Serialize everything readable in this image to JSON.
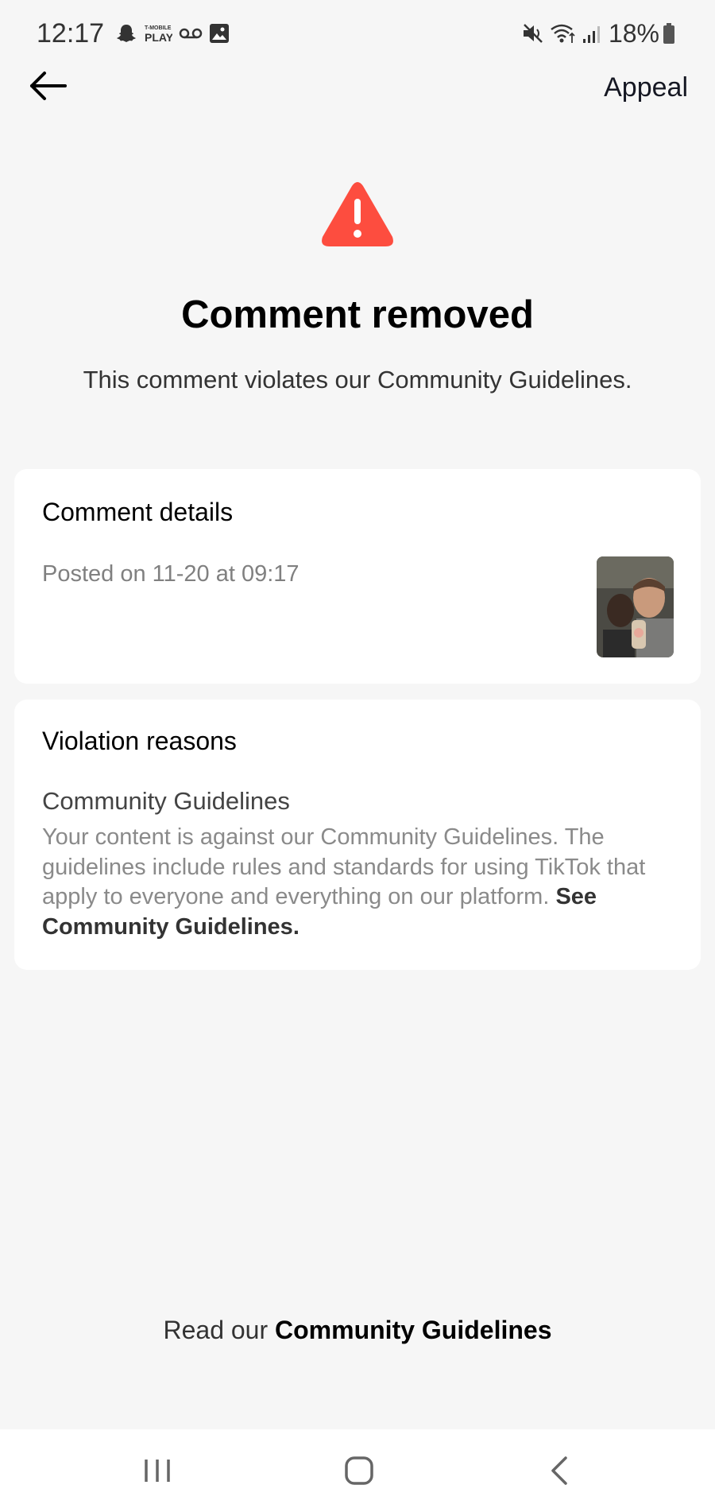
{
  "status_bar": {
    "time": "12:17",
    "battery_percent": "18%",
    "left_icons": [
      "snapchat-icon",
      "tmobile-play-icon",
      "voicemail-icon",
      "gallery-icon"
    ],
    "right_icons": [
      "mute-icon",
      "wifi-icon",
      "signal-icon",
      "battery-icon"
    ],
    "tmobile_label": "T-MOBILE",
    "play_label": "PLAY"
  },
  "nav": {
    "back_icon": "arrow-left-icon",
    "appeal_label": "Appeal"
  },
  "header": {
    "icon": "warning-triangle-icon",
    "title": "Comment removed",
    "subtitle": "This comment violates our Community Guidelines."
  },
  "comment_details": {
    "title": "Comment details",
    "posted_on": "Posted on 11-20 at 09:17",
    "thumbnail": "comment-thumbnail"
  },
  "violation": {
    "title": "Violation reasons",
    "reason_title": "Community Guidelines",
    "reason_text": "Your content is against our Community Guidelines. The guidelines include rules and standards for using TikTok that apply to everyone and everything on our platform.",
    "reason_link": "See Community Guidelines."
  },
  "footer": {
    "prefix": "Read our",
    "link": "Community Guidelines"
  },
  "system_nav": {
    "recents_icon": "recents-icon",
    "home_icon": "home-icon",
    "back_icon": "back-chevron-icon"
  },
  "colors": {
    "background": "#f6f6f6",
    "card": "#ffffff",
    "warning": "#fe2c55",
    "text_primary": "#161823",
    "text_secondary": "#8a8a8a"
  }
}
